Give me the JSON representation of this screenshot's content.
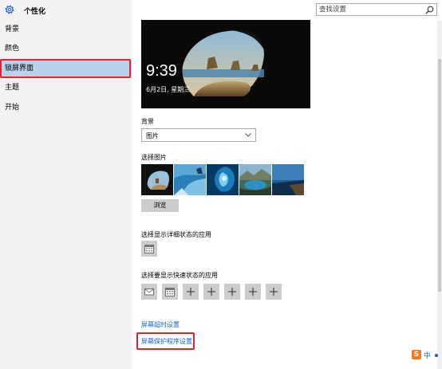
{
  "window": {
    "title": "个性化"
  },
  "search": {
    "placeholder": "查找设置"
  },
  "sidebar": {
    "items": [
      {
        "label": "背景"
      },
      {
        "label": "颜色"
      },
      {
        "label": "锁屏界面",
        "active": true
      },
      {
        "label": "主题"
      },
      {
        "label": "开始"
      }
    ]
  },
  "preview": {
    "time": "9:39",
    "date": "6月2日, 星期三"
  },
  "background": {
    "label": "背景",
    "value": "图片"
  },
  "choose_picture": {
    "label": "选择图片",
    "browse_label": "浏览"
  },
  "detailed_status": {
    "label": "选择显示详细状态的应用",
    "icon": "calendar-icon"
  },
  "quick_status": {
    "label": "选择要显示快速状态的应用",
    "icons": [
      "mail-icon",
      "calendar-icon",
      "plus-icon",
      "plus-icon",
      "plus-icon",
      "plus-icon",
      "plus-icon"
    ]
  },
  "links": {
    "timeout": "屏幕超时设置",
    "screensaver": "屏幕保护程序设置"
  },
  "ime": {
    "badge": "S",
    "lang": "中"
  },
  "colors": {
    "accent_link": "#1a62c7",
    "highlight_frame": "#e0242b",
    "active_item": "#b9d1ea"
  }
}
